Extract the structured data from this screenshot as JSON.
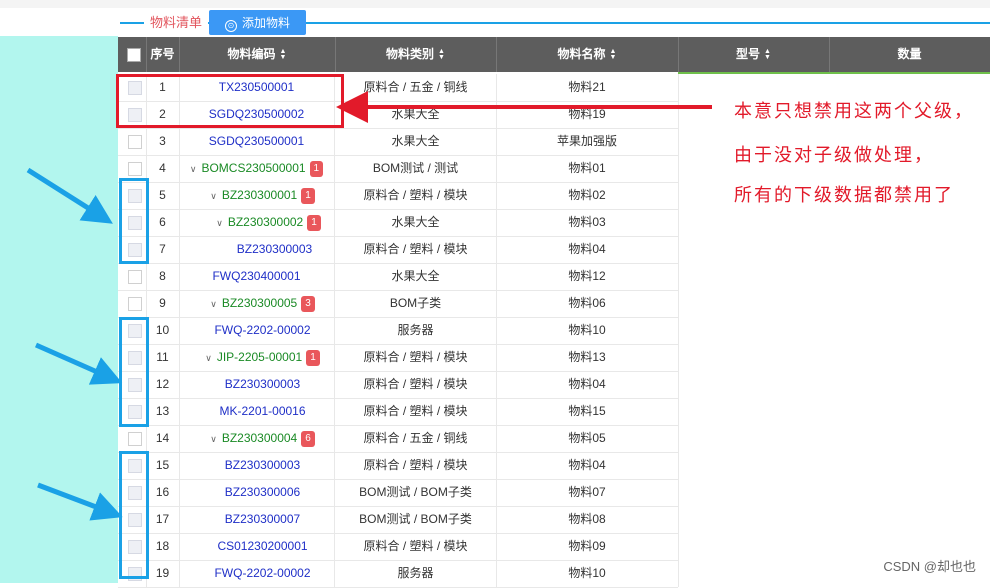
{
  "tab": {
    "label": "物料清单",
    "add_button": "添加物料"
  },
  "headers": [
    "序号",
    "物料编码",
    "物料类别",
    "物料名称",
    "型号",
    "数量"
  ],
  "rows": [
    {
      "no": "1",
      "code": "TX230500001",
      "cat": "原料合 / 五金 / 铜线",
      "name": "物料21",
      "parent": false,
      "badge": "",
      "indent": 0,
      "disabled": true
    },
    {
      "no": "2",
      "code": "SGDQ230500002",
      "cat": "水果大全",
      "name": "物料19",
      "parent": false,
      "badge": "",
      "indent": 0,
      "disabled": true
    },
    {
      "no": "3",
      "code": "SGDQ230500001",
      "cat": "水果大全",
      "name": "苹果加强版",
      "parent": false,
      "badge": "",
      "indent": 0,
      "disabled": false
    },
    {
      "no": "4",
      "code": "BOMCS230500001",
      "cat": "BOM测试 / 测试",
      "name": "物料01",
      "parent": true,
      "badge": "1",
      "indent": 0,
      "disabled": false
    },
    {
      "no": "5",
      "code": "BZ230300001",
      "cat": "原料合 / 塑料 / 模块",
      "name": "物料02",
      "parent": true,
      "badge": "1",
      "indent": 1,
      "disabled": true
    },
    {
      "no": "6",
      "code": "BZ230300002",
      "cat": "水果大全",
      "name": "物料03",
      "parent": true,
      "badge": "1",
      "indent": 2,
      "disabled": true
    },
    {
      "no": "7",
      "code": "BZ230300003",
      "cat": "原料合 / 塑料 / 模块",
      "name": "物料04",
      "parent": false,
      "badge": "",
      "indent": 3,
      "disabled": true
    },
    {
      "no": "8",
      "code": "FWQ230400001",
      "cat": "水果大全",
      "name": "物料12",
      "parent": false,
      "badge": "",
      "indent": 0,
      "disabled": false
    },
    {
      "no": "9",
      "code": "BZ230300005",
      "cat": "BOM子类",
      "name": "物料06",
      "parent": true,
      "badge": "3",
      "indent": 1,
      "disabled": false
    },
    {
      "no": "10",
      "code": "FWQ-2202-00002",
      "cat": "服务器",
      "name": "物料10",
      "parent": false,
      "badge": "",
      "indent": 1,
      "disabled": true
    },
    {
      "no": "11",
      "code": "JIP-2205-00001",
      "cat": "原料合 / 塑料 / 模块",
      "name": "物料13",
      "parent": true,
      "badge": "1",
      "indent": 1,
      "disabled": true
    },
    {
      "no": "12",
      "code": "BZ230300003",
      "cat": "原料合 / 塑料 / 模块",
      "name": "物料04",
      "parent": false,
      "badge": "",
      "indent": 1,
      "disabled": true
    },
    {
      "no": "13",
      "code": "MK-2201-00016",
      "cat": "原料合 / 塑料 / 模块",
      "name": "物料15",
      "parent": false,
      "badge": "",
      "indent": 1,
      "disabled": true
    },
    {
      "no": "14",
      "code": "BZ230300004",
      "cat": "原料合 / 五金 / 铜线",
      "name": "物料05",
      "parent": true,
      "badge": "6",
      "indent": 1,
      "disabled": false
    },
    {
      "no": "15",
      "code": "BZ230300003",
      "cat": "原料合 / 塑料 / 模块",
      "name": "物料04",
      "parent": false,
      "badge": "",
      "indent": 1,
      "disabled": true
    },
    {
      "no": "16",
      "code": "BZ230300006",
      "cat": "BOM测试 / BOM子类",
      "name": "物料07",
      "parent": false,
      "badge": "",
      "indent": 1,
      "disabled": true
    },
    {
      "no": "17",
      "code": "BZ230300007",
      "cat": "BOM测试 / BOM子类",
      "name": "物料08",
      "parent": false,
      "badge": "",
      "indent": 1,
      "disabled": true
    },
    {
      "no": "18",
      "code": "CS01230200001",
      "cat": "原料合 / 塑料 / 模块",
      "name": "物料09",
      "parent": false,
      "badge": "",
      "indent": 1,
      "disabled": true
    },
    {
      "no": "19",
      "code": "FWQ-2202-00002",
      "cat": "服务器",
      "name": "物料10",
      "parent": false,
      "badge": "",
      "indent": 1,
      "disabled": true
    }
  ],
  "annotation": {
    "line1": "本意只想禁用这两个父级，",
    "line2": "由于没对子级做处理，",
    "line3": "所有的下级数据都禁用了"
  },
  "watermark": "CSDN @却也也",
  "colors": {
    "accent": "#1aa1e6",
    "annotation": "#e21a2a",
    "header_bg": "#5d5d5d",
    "left_panel": "#b2f6ee"
  }
}
